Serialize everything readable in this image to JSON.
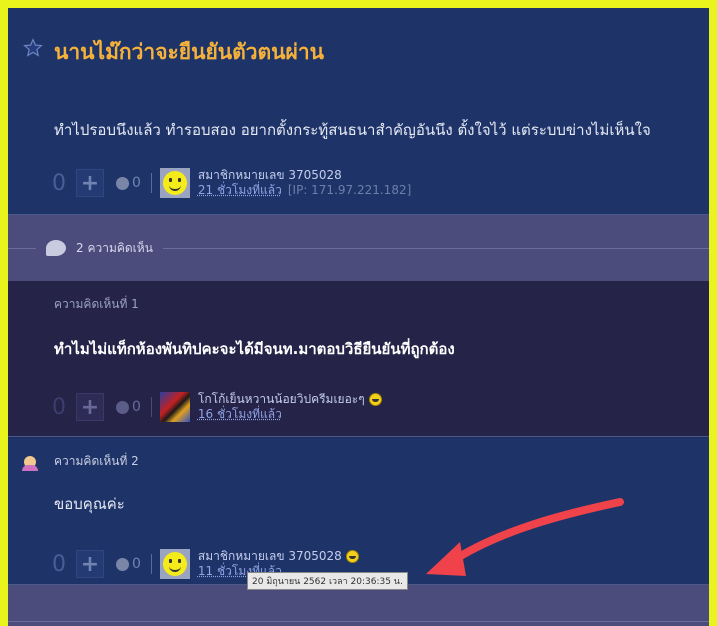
{
  "topic": {
    "title": "นานไม๊กว่าจะยืนยันตัวตนผ่าน",
    "body": "ทำไปรอบนึงแล้ว ทำรอบสอง อยากตั้งกระทู้สนธนาสำคัญอันนึง ตั้งใจไว้ แต่ระบบข่างไม่เห็นใจ",
    "votes": "0",
    "emotion_count": "0",
    "author": "สมาชิกหมายเลข 3705028",
    "time": "21 ชั่วโมงที่แล้ว",
    "ip": "[IP: 171.97.221.182]"
  },
  "comments_header": {
    "label": "2 ความคิดเห็น"
  },
  "comments": [
    {
      "label": "ความคิดเห็นที่ 1",
      "text": "ทำไมไม่แท็กห้องพันทิปคะจะได้มีจนท.มาตอบวิธียืนยันที่ถูกต้อง",
      "votes": "0",
      "emotion_count": "0",
      "author": "โกโก้เย็นหวานน้อยวิปครีมเยอะๆ",
      "time": "16 ชั่วโมงที่แล้ว"
    },
    {
      "label": "ความคิดเห็นที่ 2",
      "text": "ขอบคุณค่ะ",
      "votes": "0",
      "emotion_count": "0",
      "author": "สมาชิกหมายเลข 3705028",
      "time": "11 ชั่วโมงที่แล้ว"
    }
  ],
  "tooltip": {
    "text": "20 มิถุนายน 2562 เวลา  20:36:35 น."
  },
  "colors": {
    "title": "#f5b13a",
    "annotation_arrow": "#f0424a",
    "frame_border": "#e8f41c"
  }
}
